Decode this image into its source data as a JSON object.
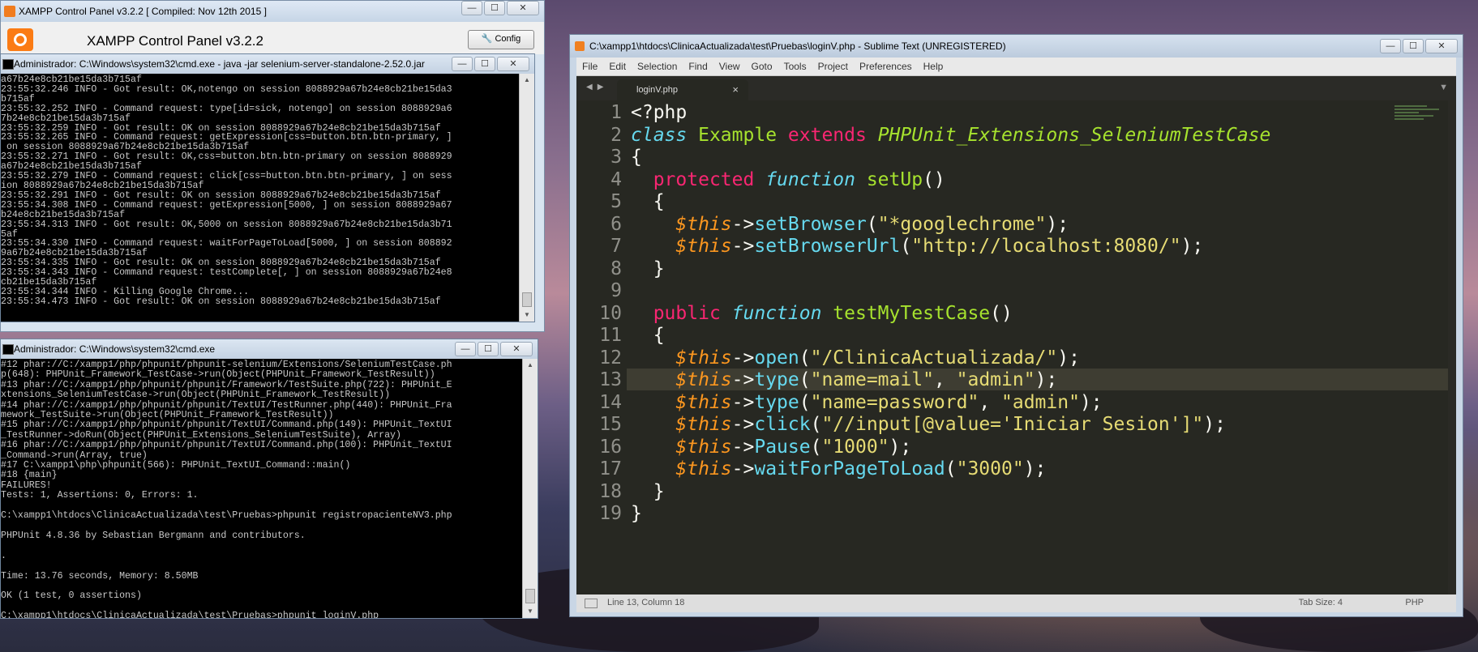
{
  "xampp": {
    "title": "XAMPP Control Panel v3.2.2   [ Compiled: Nov 12th 2015 ]",
    "heading": "XAMPP Control Panel v3.2.2",
    "config_label": "Config"
  },
  "cmd1": {
    "title": "Administrador: C:\\Windows\\system32\\cmd.exe - java  -jar selenium-server-standalone-2.52.0.jar",
    "lines": [
      "a67b24e8cb21be15da3b715af",
      "23:55:32.246 INFO - Got result: OK,notengo on session 8088929a67b24e8cb21be15da3",
      "b715af",
      "23:55:32.252 INFO - Command request: type[id=sick, notengo] on session 8088929a6",
      "7b24e8cb21be15da3b715af",
      "23:55:32.259 INFO - Got result: OK on session 8088929a67b24e8cb21be15da3b715af",
      "23:55:32.265 INFO - Command request: getExpression[css=button.btn.btn-primary, ]",
      " on session 8088929a67b24e8cb21be15da3b715af",
      "23:55:32.271 INFO - Got result: OK,css=button.btn.btn-primary on session 8088929",
      "a67b24e8cb21be15da3b715af",
      "23:55:32.279 INFO - Command request: click[css=button.btn.btn-primary, ] on sess",
      "ion 8088929a67b24e8cb21be15da3b715af",
      "23:55:32.291 INFO - Got result: OK on session 8088929a67b24e8cb21be15da3b715af",
      "23:55:34.308 INFO - Command request: getExpression[5000, ] on session 8088929a67",
      "b24e8cb21be15da3b715af",
      "23:55:34.313 INFO - Got result: OK,5000 on session 8088929a67b24e8cb21be15da3b71",
      "5af",
      "23:55:34.330 INFO - Command request: waitForPageToLoad[5000, ] on session 808892",
      "9a67b24e8cb21be15da3b715af",
      "23:55:34.335 INFO - Got result: OK on session 8088929a67b24e8cb21be15da3b715af",
      "23:55:34.343 INFO - Command request: testComplete[, ] on session 8088929a67b24e8",
      "cb21be15da3b715af",
      "23:55:34.344 INFO - Killing Google Chrome...",
      "23:55:34.473 INFO - Got result: OK on session 8088929a67b24e8cb21be15da3b715af"
    ]
  },
  "cmd2": {
    "title": "Administrador: C:\\Windows\\system32\\cmd.exe",
    "lines": [
      "#12 phar://C:/xampp1/php/phpunit/phpunit-selenium/Extensions/SeleniumTestCase.ph",
      "p(648): PHPUnit_Framework_TestCase->run(Object(PHPUnit_Framework_TestResult))",
      "#13 phar://C:/xampp1/php/phpunit/phpunit/Framework/TestSuite.php(722): PHPUnit_E",
      "xtensions_SeleniumTestCase->run(Object(PHPUnit_Framework_TestResult))",
      "#14 phar://C:/xampp1/php/phpunit/phpunit/TextUI/TestRunner.php(440): PHPUnit_Fra",
      "mework_TestSuite->run(Object(PHPUnit_Framework_TestResult))",
      "#15 phar://C:/xampp1/php/phpunit/phpunit/TextUI/Command.php(149): PHPUnit_TextUI",
      "_TestRunner->doRun(Object(PHPUnit_Extensions_SeleniumTestSuite), Array)",
      "#16 phar://C:/xampp1/php/phpunit/phpunit/TextUI/Command.php(100): PHPUnit_TextUI",
      "_Command->run(Array, true)",
      "#17 C:\\xampp1\\php\\phpunit(566): PHPUnit_TextUI_Command::main()",
      "#18 {main}",
      "FAILURES!",
      "Tests: 1, Assertions: 0, Errors: 1.",
      "",
      "C:\\xampp1\\htdocs\\ClinicaActualizada\\test\\Pruebas>phpunit registropacienteNV3.php",
      "",
      "PHPUnit 4.8.36 by Sebastian Bergmann and contributors.",
      "",
      ".",
      "",
      "Time: 13.76 seconds, Memory: 8.50MB",
      "",
      "OK (1 test, 0 assertions)",
      "",
      "C:\\xampp1\\htdocs\\ClinicaActualizada\\test\\Pruebas>phpunit loginV.php"
    ]
  },
  "sublime": {
    "title": "C:\\xampp1\\htdocs\\ClinicaActualizada\\test\\Pruebas\\loginV.php - Sublime Text (UNREGISTERED)",
    "menu": [
      "File",
      "Edit",
      "Selection",
      "Find",
      "View",
      "Goto",
      "Tools",
      "Project",
      "Preferences",
      "Help"
    ],
    "tab_label": "loginV.php",
    "line_numbers": [
      "1",
      "2",
      "3",
      "4",
      "5",
      "6",
      "7",
      "8",
      "9",
      "10",
      "11",
      "12",
      "13",
      "14",
      "15",
      "16",
      "17",
      "18",
      "19"
    ],
    "code": [
      [
        [
          "p",
          "<?php"
        ]
      ],
      [
        [
          "st",
          "class"
        ],
        [
          "p",
          " "
        ],
        [
          "cl",
          "Example"
        ],
        [
          "p",
          " "
        ],
        [
          "kw",
          "extends"
        ],
        [
          "p",
          " "
        ],
        [
          "inh",
          "PHPUnit_Extensions_SeleniumTestCase"
        ]
      ],
      [
        [
          "p",
          "{"
        ]
      ],
      [
        [
          "p",
          "  "
        ],
        [
          "kw",
          "protected"
        ],
        [
          "p",
          " "
        ],
        [
          "st",
          "function"
        ],
        [
          "p",
          " "
        ],
        [
          "fn",
          "setUp"
        ],
        [
          "p",
          "()"
        ]
      ],
      [
        [
          "p",
          "  {"
        ]
      ],
      [
        [
          "p",
          "    "
        ],
        [
          "var",
          "$this"
        ],
        [
          "p",
          "->"
        ],
        [
          "m",
          "setBrowser"
        ],
        [
          "p",
          "("
        ],
        [
          "s",
          "\"*googlechrome\""
        ],
        [
          "p",
          ");"
        ]
      ],
      [
        [
          "p",
          "    "
        ],
        [
          "var",
          "$this"
        ],
        [
          "p",
          "->"
        ],
        [
          "m",
          "setBrowserUrl"
        ],
        [
          "p",
          "("
        ],
        [
          "s",
          "\"http://localhost:8080/\""
        ],
        [
          "p",
          ");"
        ]
      ],
      [
        [
          "p",
          "  }"
        ]
      ],
      [
        [
          "p",
          ""
        ]
      ],
      [
        [
          "p",
          "  "
        ],
        [
          "kw",
          "public"
        ],
        [
          "p",
          " "
        ],
        [
          "st",
          "function"
        ],
        [
          "p",
          " "
        ],
        [
          "fn",
          "testMyTestCase"
        ],
        [
          "p",
          "()"
        ]
      ],
      [
        [
          "p",
          "  {"
        ]
      ],
      [
        [
          "p",
          "    "
        ],
        [
          "var",
          "$this"
        ],
        [
          "p",
          "->"
        ],
        [
          "m",
          "open"
        ],
        [
          "p",
          "("
        ],
        [
          "s",
          "\"/ClinicaActualizada/\""
        ],
        [
          "p",
          ");"
        ]
      ],
      [
        [
          "p",
          "    "
        ],
        [
          "var",
          "$this"
        ],
        [
          "p",
          "->"
        ],
        [
          "m",
          "type"
        ],
        [
          "p",
          "("
        ],
        [
          "s",
          "\"name=mail\""
        ],
        [
          "p",
          ", "
        ],
        [
          "s",
          "\"admin\""
        ],
        [
          "p",
          ");"
        ]
      ],
      [
        [
          "p",
          "    "
        ],
        [
          "var",
          "$this"
        ],
        [
          "p",
          "->"
        ],
        [
          "m",
          "type"
        ],
        [
          "p",
          "("
        ],
        [
          "s",
          "\"name=password\""
        ],
        [
          "p",
          ", "
        ],
        [
          "s",
          "\"admin\""
        ],
        [
          "p",
          ");"
        ]
      ],
      [
        [
          "p",
          "    "
        ],
        [
          "var",
          "$this"
        ],
        [
          "p",
          "->"
        ],
        [
          "m",
          "click"
        ],
        [
          "p",
          "("
        ],
        [
          "s",
          "\"//input[@value='Iniciar Sesion']\""
        ],
        [
          "p",
          ");"
        ]
      ],
      [
        [
          "p",
          "    "
        ],
        [
          "var",
          "$this"
        ],
        [
          "p",
          "->"
        ],
        [
          "m",
          "Pause"
        ],
        [
          "p",
          "("
        ],
        [
          "s",
          "\"1000\""
        ],
        [
          "p",
          ");"
        ]
      ],
      [
        [
          "p",
          "    "
        ],
        [
          "var",
          "$this"
        ],
        [
          "p",
          "->"
        ],
        [
          "m",
          "waitForPageToLoad"
        ],
        [
          "p",
          "("
        ],
        [
          "s",
          "\"3000\""
        ],
        [
          "p",
          ");"
        ]
      ],
      [
        [
          "p",
          "  }"
        ]
      ],
      [
        [
          "p",
          "}"
        ]
      ]
    ],
    "current_line": 13,
    "status_position": "Line 13, Column 18",
    "status_tab": "Tab Size: 4",
    "status_syntax": "PHP"
  }
}
